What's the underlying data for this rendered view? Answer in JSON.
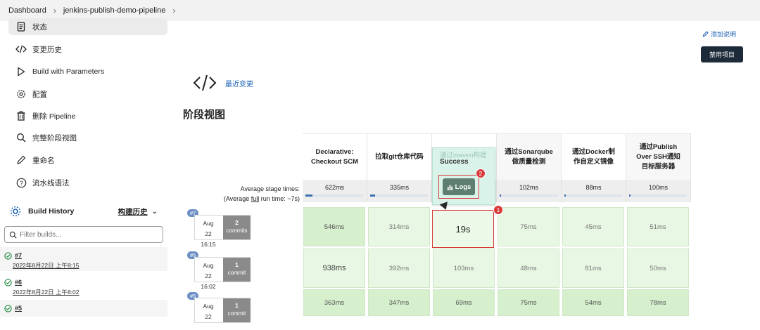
{
  "breadcrumb": [
    "Dashboard",
    "jenkins-publish-demo-pipeline"
  ],
  "sidebar": {
    "items": [
      {
        "label": "状态",
        "icon": "document-icon"
      },
      {
        "label": "变更历史",
        "icon": "code-icon"
      },
      {
        "label": "Build with Parameters",
        "icon": "play-icon"
      },
      {
        "label": "配置",
        "icon": "gear-icon"
      },
      {
        "label": "删除 Pipeline",
        "icon": "trash-icon"
      },
      {
        "label": "完整阶段视图",
        "icon": "search-icon"
      },
      {
        "label": "重命名",
        "icon": "pencil-icon"
      },
      {
        "label": "流水线语法",
        "icon": "help-icon"
      }
    ],
    "build_history": {
      "title": "Build History",
      "title_zh": "构建历史"
    },
    "filter_placeholder": "Filter builds...",
    "builds": [
      {
        "number": "#7",
        "date": "2022年8月22日 上午8:15"
      },
      {
        "number": "#6",
        "date": "2022年8月22日 上午8:02"
      },
      {
        "number": "#5",
        "date": ""
      }
    ]
  },
  "main": {
    "add_description": "添加说明",
    "disable_button": "禁用项目",
    "recent_changes": "最近变更",
    "stage_view_title": "阶段视图",
    "avg_label_line1": "Average stage times:",
    "avg_label_pre": "(Average ",
    "avg_label_full": "full",
    "avg_label_post": " run time: ~7s)"
  },
  "stages": [
    {
      "name_lines": [
        "Declarative:",
        "Checkout SCM"
      ],
      "avg": "622ms",
      "fill": 0.12
    },
    {
      "name_lines": [
        "拉取git仓库代码"
      ],
      "avg": "335ms",
      "fill": 0.08
    },
    {
      "name_lines": [
        "通过maven构建"
      ],
      "avg": "",
      "fill": 0
    },
    {
      "name_lines": [
        "通过Sonarqube",
        "做质量检测"
      ],
      "avg": "102ms",
      "fill": 0.03
    },
    {
      "name_lines": [
        "通过Docker制",
        "作自定义镜像"
      ],
      "avg": "88ms",
      "fill": 0.03
    },
    {
      "name_lines": [
        "通过Publish",
        "Over SSH通知",
        "目标服务器"
      ],
      "avg": "100ms",
      "fill": 0.03
    }
  ],
  "runs": [
    {
      "badge": "#7",
      "month_day": "Aug 22",
      "time": "16:15",
      "commits_count": "2",
      "commits_label": "commits",
      "cells": [
        "546ms",
        "314ms",
        "19s",
        "75ms",
        "45ms",
        "51ms"
      ]
    },
    {
      "badge": "#6",
      "month_day": "Aug 22",
      "time": "16:02",
      "commits_count": "1",
      "commits_label": "commit",
      "cells": [
        "938ms",
        "392ms",
        "103ms",
        "48ms",
        "81ms",
        "50ms"
      ]
    },
    {
      "badge": "#5",
      "month_day": "Aug 22",
      "time": "",
      "commits_count": "1",
      "commits_label": "commit",
      "cells": [
        "363ms",
        "347ms",
        "69ms",
        "75ms",
        "54ms",
        "78ms"
      ]
    }
  ],
  "popup": {
    "stage": "通过maven构建",
    "status": "Success",
    "logs_label": "Logs"
  },
  "markers": [
    "1",
    "2"
  ]
}
